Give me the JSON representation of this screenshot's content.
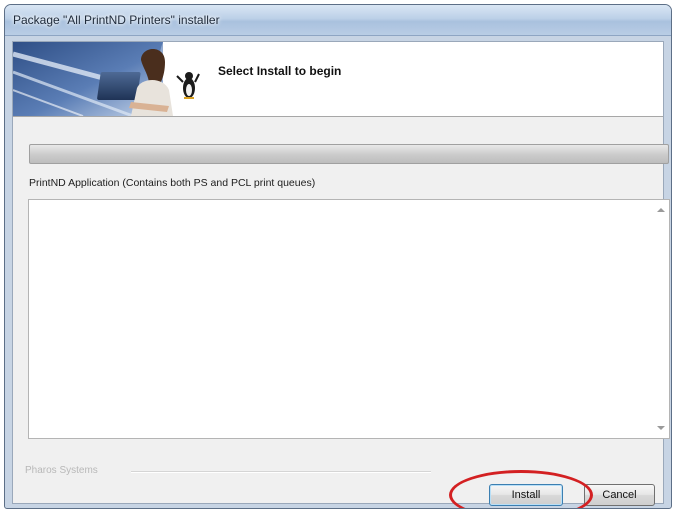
{
  "window": {
    "title": "Package \"All PrintND Printers\" installer"
  },
  "banner": {
    "title": "Select Install to begin",
    "graphic": "woman-with-laptop-and-mascot-illustration"
  },
  "progress": {
    "fraction": 0
  },
  "component": {
    "label": "PrintND Application (Contains both PS and PCL print queues)"
  },
  "details": {
    "text": ""
  },
  "footer": {
    "group_label": "Pharos Systems"
  },
  "buttons": {
    "install_label": "Install",
    "cancel_label": "Cancel"
  },
  "annotation": {
    "highlight_color": "#d32022",
    "highlight_target": "install-button"
  },
  "icons": [
    "scroll-up-arrow-icon",
    "scroll-down-arrow-icon"
  ]
}
